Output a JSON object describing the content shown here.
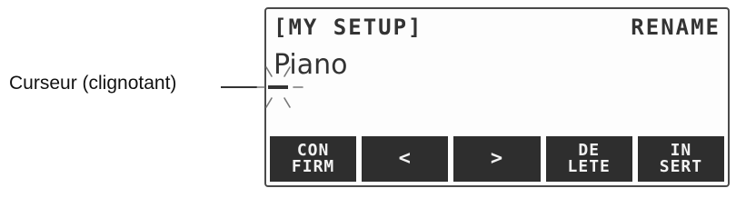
{
  "callout": {
    "label": "Curseur (clignotant)"
  },
  "lcd": {
    "title": "[MY SETUP]",
    "mode": "RENAME",
    "name": "Piano"
  },
  "softkeys": [
    {
      "label": "CON\nFIRM",
      "icon": ""
    },
    {
      "label": "<",
      "icon": "left-arrow-icon"
    },
    {
      "label": ">",
      "icon": "right-arrow-icon"
    },
    {
      "label": "DE\nLETE",
      "icon": ""
    },
    {
      "label": "IN\nSERT",
      "icon": ""
    }
  ]
}
